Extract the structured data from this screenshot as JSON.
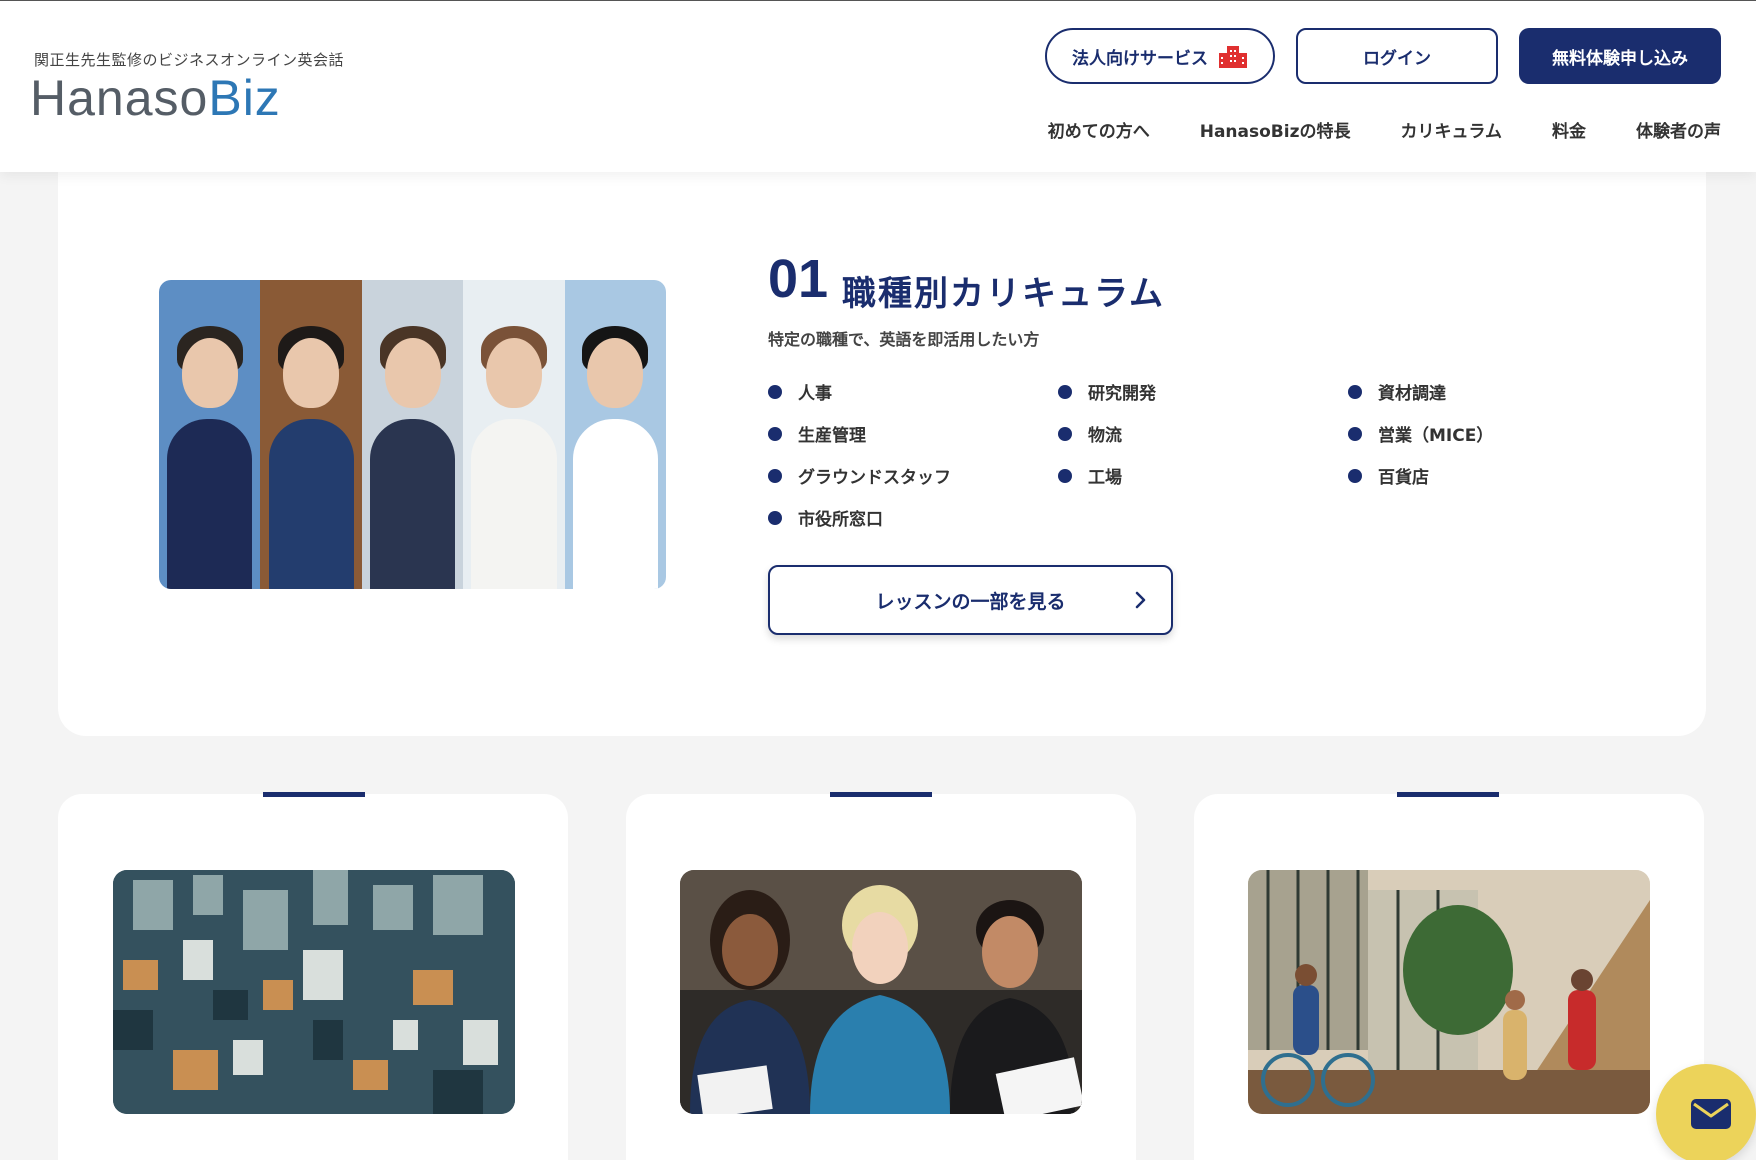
{
  "header": {
    "tagline": "関正生先生監修のビジネスオンライン英会話",
    "logo_part1": "Hanaso",
    "logo_part2": "Biz",
    "corporate_button": "法人向けサービス",
    "login_button": "ログイン",
    "trial_button": "無料体験申し込み",
    "nav": [
      "初めての方へ",
      "HanasoBizの特長",
      "カリキュラム",
      "料金",
      "体験者の声"
    ]
  },
  "course": {
    "number": "01",
    "title": "職種別カリキュラム",
    "subtitle": "特定の職種で、英語を即活用したい方",
    "jobs": [
      "人事",
      "研究開発",
      "資材調達",
      "生産管理",
      "物流",
      "営業（MICE）",
      "グラウンドスタッフ",
      "工場",
      "百貨店",
      "市役所窓口"
    ],
    "lesson_button": "レッスンの一部を見る"
  },
  "icons": {
    "corporate": "building-icon",
    "lesson_arrow": "chevron-right-icon",
    "chat": "envelope-icon"
  },
  "colors": {
    "brand_navy": "#1a2d6e",
    "logo_blue": "#2d77b5",
    "chat_yellow": "#ecd35a",
    "building_red": "#e03030"
  }
}
